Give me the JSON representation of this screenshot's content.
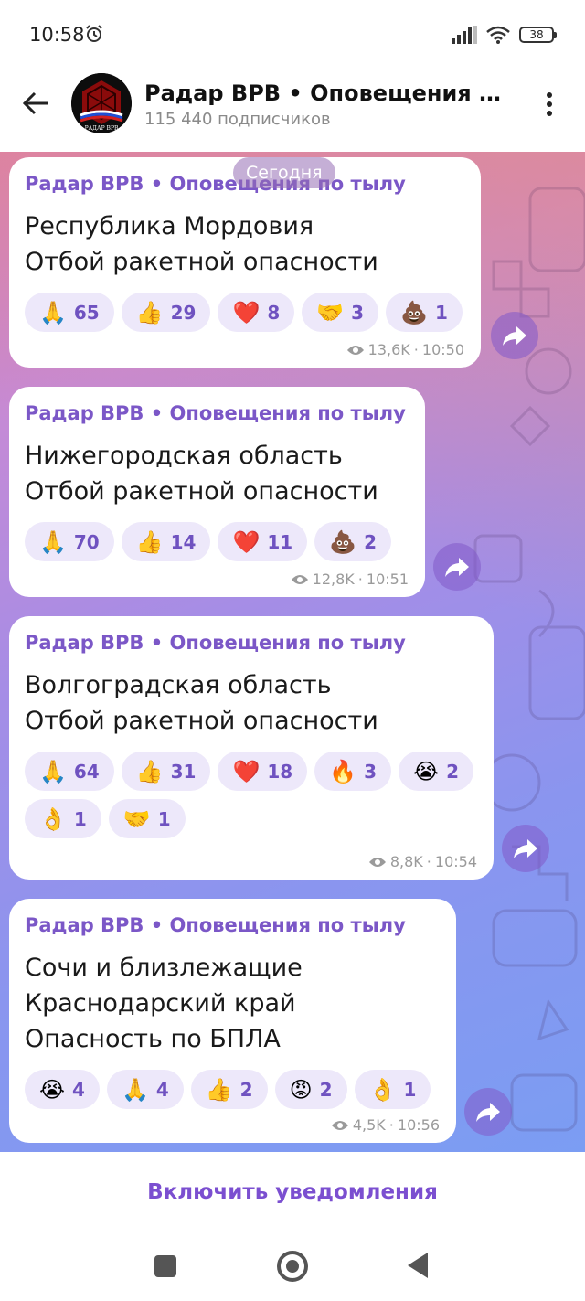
{
  "status_bar": {
    "time": "10:58",
    "battery": "38"
  },
  "header": {
    "title": "Радар ВРВ • Оповещения по…",
    "subscribers": "115 440 подписчиков",
    "avatar_text": "РАДАР ВРВ"
  },
  "chat": {
    "date_label": "Сегодня",
    "messages": [
      {
        "channel": "Радар ВРВ • Оповещения по тылу",
        "lines": [
          "Республика Мордовия",
          "Отбой ракетной опасности"
        ],
        "reactions": [
          {
            "emoji": "🙏",
            "count": "65"
          },
          {
            "emoji": "👍",
            "count": "29"
          },
          {
            "emoji": "❤️",
            "count": "8"
          },
          {
            "emoji": "🤝",
            "count": "3"
          },
          {
            "emoji": "💩",
            "count": "1"
          }
        ],
        "views": "13,6K",
        "time": "10:50"
      },
      {
        "channel": "Радар ВРВ • Оповещения по тылу",
        "lines": [
          "Нижегородская область",
          "Отбой ракетной опасности"
        ],
        "reactions": [
          {
            "emoji": "🙏",
            "count": "70"
          },
          {
            "emoji": "👍",
            "count": "14"
          },
          {
            "emoji": "❤️",
            "count": "11"
          },
          {
            "emoji": "💩",
            "count": "2"
          }
        ],
        "views": "12,8K",
        "time": "10:51"
      },
      {
        "channel": "Радар ВРВ • Оповещения по тылу",
        "lines": [
          "Волгоградская область",
          "Отбой ракетной опасности"
        ],
        "reactions": [
          {
            "emoji": "🙏",
            "count": "64"
          },
          {
            "emoji": "👍",
            "count": "31"
          },
          {
            "emoji": "❤️",
            "count": "18"
          },
          {
            "emoji": "🔥",
            "count": "3"
          },
          {
            "emoji": "😭",
            "count": "2"
          },
          {
            "emoji": "👌",
            "count": "1"
          },
          {
            "emoji": "🤝",
            "count": "1"
          }
        ],
        "views": "8,8K",
        "time": "10:54"
      },
      {
        "channel": "Радар ВРВ • Оповещения по тылу",
        "lines": [
          "Сочи и близлежащие",
          "Краснодарский край",
          "Опасность по БПЛА"
        ],
        "reactions": [
          {
            "emoji": "😭",
            "count": "4"
          },
          {
            "emoji": "🙏",
            "count": "4"
          },
          {
            "emoji": "👍",
            "count": "2"
          },
          {
            "emoji": "😡",
            "count": "2"
          },
          {
            "emoji": "👌",
            "count": "1"
          }
        ],
        "views": "4,5K",
        "time": "10:56"
      }
    ]
  },
  "footer": {
    "notify_label": "Включить уведомления"
  }
}
